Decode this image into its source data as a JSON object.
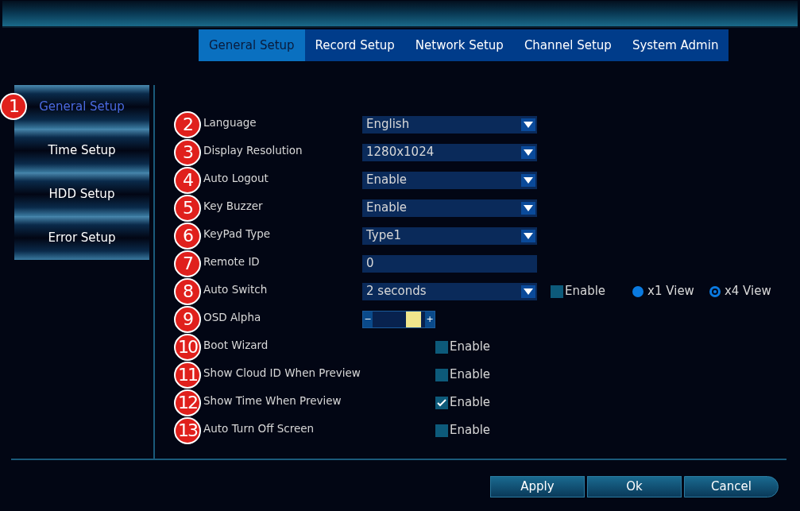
{
  "tabs": [
    {
      "label": "General Setup",
      "selected": true
    },
    {
      "label": "Record Setup",
      "selected": false
    },
    {
      "label": "Network Setup",
      "selected": false
    },
    {
      "label": "Channel Setup",
      "selected": false
    },
    {
      "label": "System Admin",
      "selected": false
    }
  ],
  "sidebar": {
    "badge": "1",
    "items": [
      {
        "label": "General Setup",
        "selected": true
      },
      {
        "label": "Time Setup",
        "selected": false
      },
      {
        "label": "HDD Setup",
        "selected": false
      },
      {
        "label": "Error Setup",
        "selected": false
      }
    ]
  },
  "settings": [
    {
      "badge": "2",
      "label": "Language",
      "kind": "select",
      "value": "English"
    },
    {
      "badge": "3",
      "label": "Display Resolution",
      "kind": "select",
      "value": "1280x1024"
    },
    {
      "badge": "4",
      "label": "Auto Logout",
      "kind": "select",
      "value": "Enable"
    },
    {
      "badge": "5",
      "label": "Key Buzzer",
      "kind": "select",
      "value": "Enable"
    },
    {
      "badge": "6",
      "label": "KeyPad Type",
      "kind": "select",
      "value": "Type1"
    },
    {
      "badge": "7",
      "label": "Remote ID",
      "kind": "input",
      "value": "0"
    },
    {
      "badge": "8",
      "label": "Auto Switch",
      "kind": "switch",
      "value": "2 seconds",
      "checkbox": {
        "label": "Enable",
        "checked": false
      },
      "views": [
        {
          "label": "x1 View",
          "selected": false
        },
        {
          "label": "x4 View",
          "selected": true
        }
      ]
    },
    {
      "badge": "9",
      "label": "OSD Alpha",
      "kind": "slider",
      "level": 0.9,
      "minus": "−",
      "plus": "+"
    },
    {
      "badge": "10",
      "label": "Boot Wizard",
      "kind": "checkbox",
      "option": "Enable",
      "checked": false
    },
    {
      "badge": "11",
      "label": "Show Cloud ID When Preview",
      "kind": "checkbox",
      "option": "Enable",
      "checked": false
    },
    {
      "badge": "12",
      "label": "Show Time When Preview",
      "kind": "checkbox",
      "option": "Enable",
      "checked": true
    },
    {
      "badge": "13",
      "label": "Auto Turn Off Screen",
      "kind": "checkbox",
      "option": "Enable",
      "checked": false
    }
  ],
  "buttons": [
    "Apply",
    "Ok",
    "Cancel"
  ]
}
